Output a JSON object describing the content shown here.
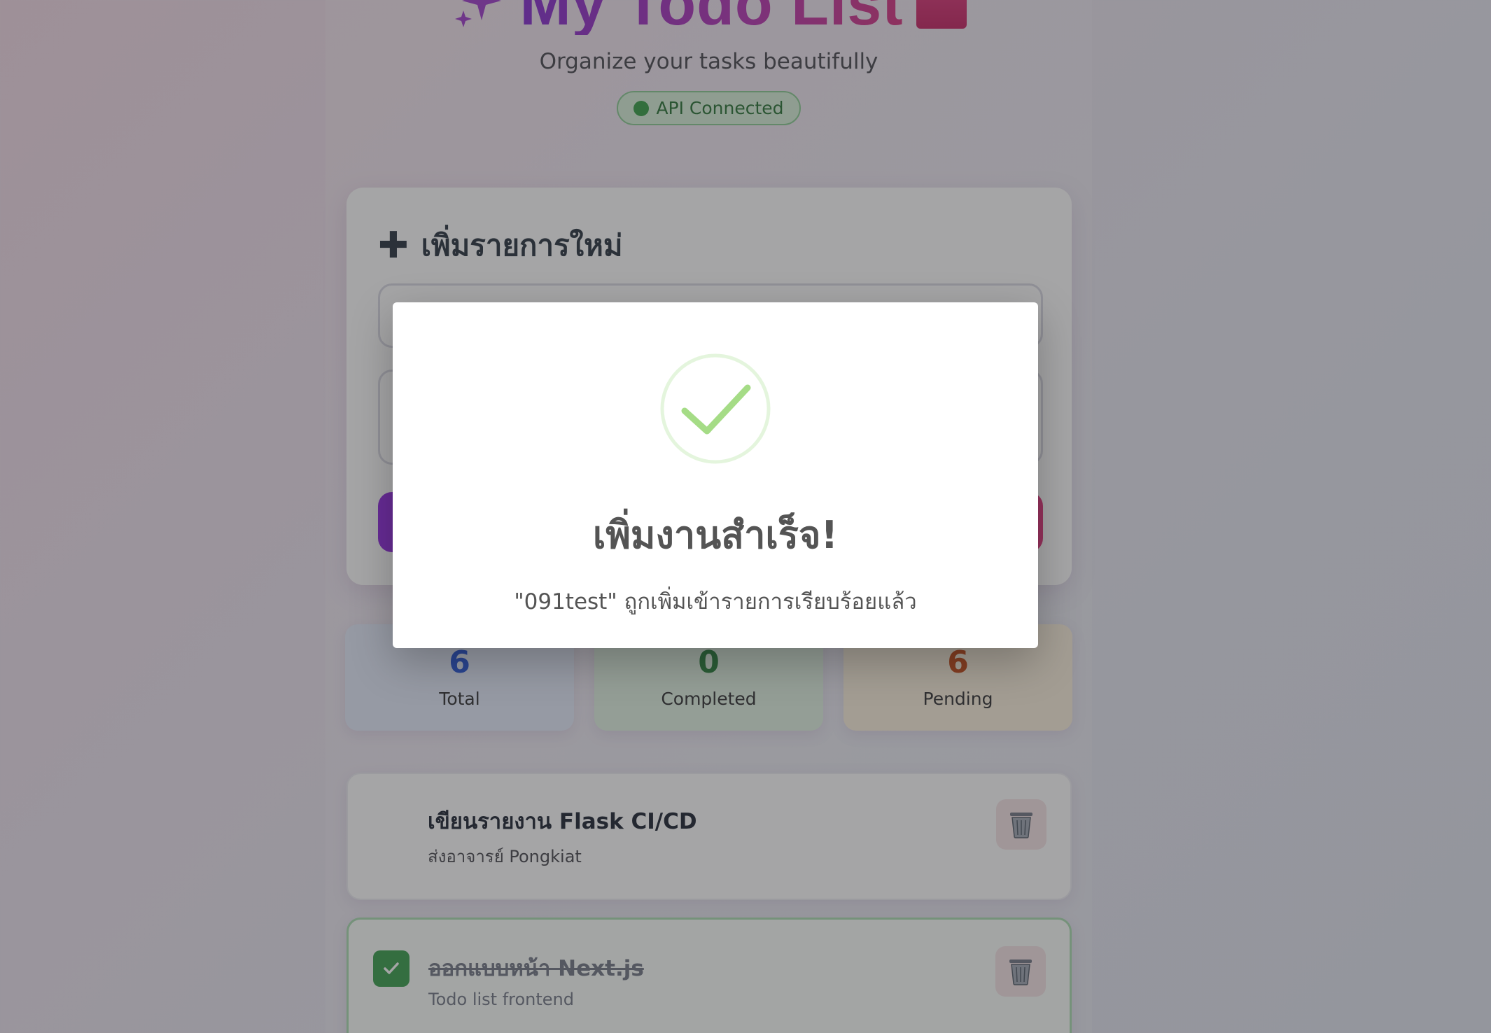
{
  "header": {
    "title": "My Todo List",
    "subtitle": "Organize your tasks beautifully",
    "api_status": "API Connected"
  },
  "add_form": {
    "heading": "เพิ่มรายการใหม่",
    "title_placeholder": "",
    "description_placeholder": "",
    "submit_label": ""
  },
  "stats": {
    "total": {
      "value": "6",
      "label": "Total"
    },
    "completed": {
      "value": "0",
      "label": "Completed"
    },
    "pending": {
      "value": "6",
      "label": "Pending"
    }
  },
  "todos": [
    {
      "title": "เขียนรายงาน Flask CI/CD",
      "description": "ส่งอาจารย์ Pongkiat",
      "completed": false
    },
    {
      "title": "ออกแบบหน้า Next.js",
      "description": "Todo list frontend",
      "completed": true
    }
  ],
  "modal": {
    "title": "เพิ่มงานสำเร็จ!",
    "message": "\"091test\" ถูกเพิ่มเข้ารายการเรียบร้อยแล้ว",
    "icon": "success-check-icon"
  },
  "colors": {
    "accent_purple": "#8b1fe0",
    "accent_pink": "#e22a76",
    "success_green": "#2f9a44",
    "total_blue": "#1d4ed8",
    "pending_orange": "#c2410c"
  }
}
